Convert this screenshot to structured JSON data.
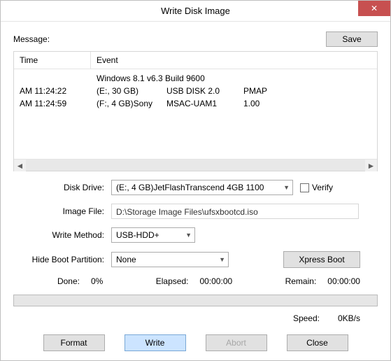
{
  "window": {
    "title": "Write Disk Image"
  },
  "message": {
    "label": "Message:",
    "save": "Save"
  },
  "columns": {
    "time": "Time",
    "event": "Event"
  },
  "log": [
    {
      "time": "",
      "a": "Windows 8.1 v6.3 Build 9600",
      "b": "",
      "c": ""
    },
    {
      "time": "AM 11:24:22",
      "a": "(E:, 30 GB)",
      "b": "USB DISK 2.0",
      "c": "PMAP"
    },
    {
      "time": "AM 11:24:59",
      "a": "(F:, 4 GB)Sony",
      "b": "MSAC-UAM1",
      "c": "1.00"
    }
  ],
  "form": {
    "disk_label": "Disk Drive:",
    "disk_value": "(E:, 4 GB)JetFlashTranscend 4GB   1100",
    "verify": "Verify",
    "image_label": "Image File:",
    "image_value": "D:\\Storage Image Files\\ufsxbootcd.iso",
    "method_label": "Write Method:",
    "method_value": "USB-HDD+",
    "hide_label": "Hide Boot Partition:",
    "hide_value": "None",
    "xpress": "Xpress Boot"
  },
  "stats": {
    "done_label": "Done:",
    "done": "0%",
    "elapsed_label": "Elapsed:",
    "elapsed": "00:00:00",
    "remain_label": "Remain:",
    "remain": "00:00:00",
    "speed_label": "Speed:",
    "speed": "0KB/s"
  },
  "buttons": {
    "format": "Format",
    "write": "Write",
    "abort": "Abort",
    "close": "Close"
  }
}
